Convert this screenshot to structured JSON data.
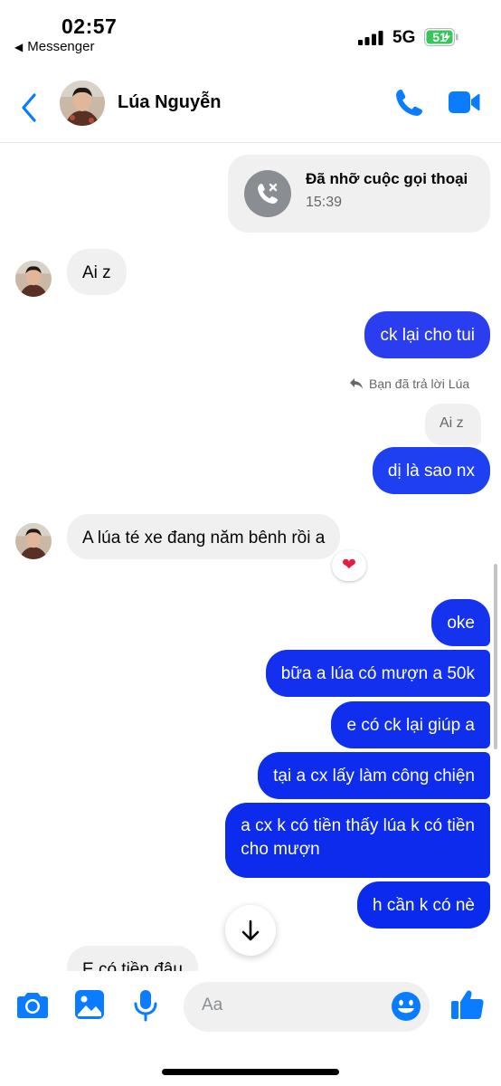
{
  "status_bar": {
    "time": "02:57",
    "back_app_label": "Messenger",
    "network": "5G",
    "battery_percent": "51"
  },
  "header": {
    "contact_name": "Lúa Nguyễn"
  },
  "colors": {
    "accent": "#0a7cff",
    "outgoing_top": "#6e5cf5",
    "outgoing_bottom": "#0a2ce8",
    "incoming": "#f0f0f0"
  },
  "messages": {
    "missed_call": {
      "title": "Đã nhỡ cuộc gọi thoại",
      "time": "15:39"
    },
    "m1": "Ai z",
    "m2": "ck lại cho tui",
    "reply_note": "Bạn đã trả lời Lúa",
    "quoted_text": "Ai z",
    "m3": "dị là sao nx",
    "m4": "A lúa  té xe đang  năm bênh rồi  a",
    "reaction": "❤",
    "m5": "oke",
    "m6": "bữa a lúa có mượn a 50k",
    "m7": "e có ck lại giúp a",
    "m8": "tại a cx lấy làm công chiện",
    "m9_line1": "a cx k có tiền thấy lúa k có tiền",
    "m9_line2": "cho mượn",
    "m10": "h cần k có nè",
    "m11": "E có  tiền đâu"
  },
  "composer": {
    "placeholder": "Aa"
  }
}
